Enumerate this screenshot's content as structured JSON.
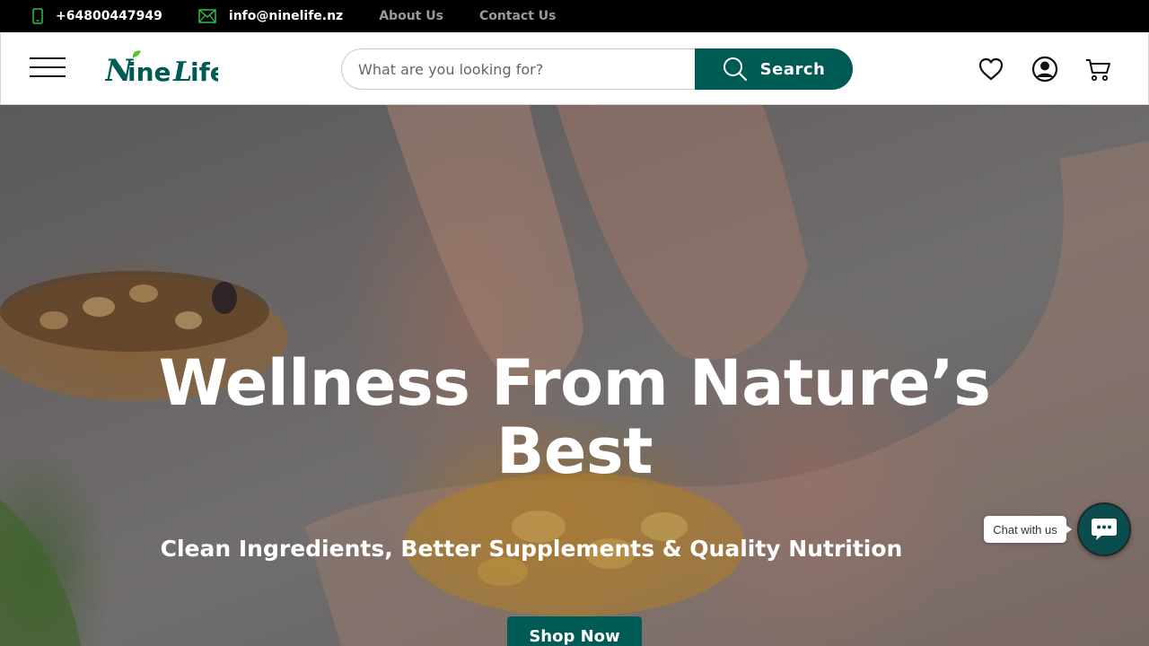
{
  "topbar": {
    "phone": "+64800447949",
    "email": "info@ninelife.nz",
    "about_label": "About Us",
    "contact_label": "Contact Us"
  },
  "header": {
    "logo_text": "NineLife",
    "search_placeholder": "What are you looking for?",
    "search_button_label": "Search",
    "icons": [
      "menu-icon",
      "heart-icon",
      "account-icon",
      "cart-icon"
    ]
  },
  "hero": {
    "title": "Wellness From Nature’s Best",
    "subtitle": "Clean Ingredients, Better Supplements & Quality Nutrition",
    "cta_label": "Shop Now"
  },
  "chat": {
    "label": "Chat with us"
  },
  "colors": {
    "brand": "#015b55",
    "topbar_bg": "#000000",
    "accent_green": "#2fbf4a"
  }
}
